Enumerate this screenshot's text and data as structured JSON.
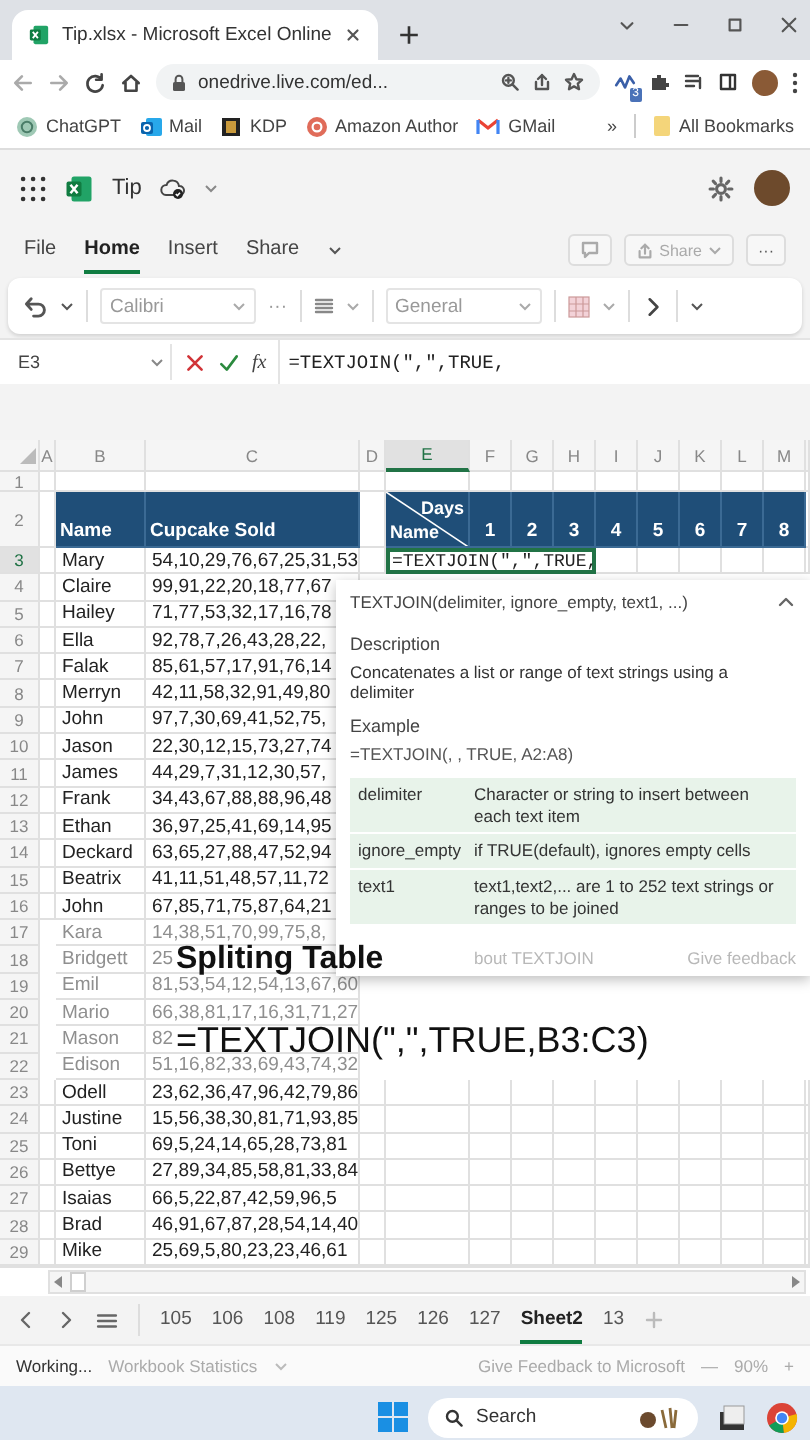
{
  "browser": {
    "tab_title": "Tip.xlsx - Microsoft Excel Online",
    "url": "onedrive.live.com/ed...",
    "extension_badge": "3",
    "bookmarks": [
      {
        "label": "ChatGPT",
        "kind": "ai"
      },
      {
        "label": "Mail",
        "kind": "mail"
      },
      {
        "label": "KDP",
        "kind": "book"
      },
      {
        "label": "Amazon Author",
        "kind": "author"
      },
      {
        "label": "GMail",
        "kind": "gmail"
      }
    ],
    "more": "»",
    "all_bookmarks": "All Bookmarks"
  },
  "app": {
    "file_name": "Tip"
  },
  "ribbon": {
    "tabs": [
      {
        "label": "File",
        "selected": false
      },
      {
        "label": "Home",
        "selected": true
      },
      {
        "label": "Insert",
        "selected": false
      },
      {
        "label": "Share",
        "selected": false
      }
    ],
    "share": "Share",
    "more": "···"
  },
  "toolbar": {
    "font": "Calibri",
    "more": "···",
    "number_format": "General"
  },
  "formula_bar": {
    "name_box": "E3",
    "fx": "fx",
    "formula": "=TEXTJOIN(\",\",TRUE,"
  },
  "sheet": {
    "columns": [
      {
        "label": "A",
        "selected": false
      },
      {
        "label": "B",
        "selected": false
      },
      {
        "label": "C",
        "selected": false
      },
      {
        "label": "D",
        "selected": false
      },
      {
        "label": "E",
        "selected": true
      },
      {
        "label": "F",
        "selected": false
      },
      {
        "label": "G",
        "selected": false
      },
      {
        "label": "H",
        "selected": false
      },
      {
        "label": "I",
        "selected": false
      },
      {
        "label": "J",
        "selected": false
      },
      {
        "label": "K",
        "selected": false
      },
      {
        "label": "L",
        "selected": false
      },
      {
        "label": "M",
        "selected": false
      }
    ],
    "empty_row": "1",
    "header": {
      "number": "2",
      "name": "Name",
      "sold": "Cupcake Sold",
      "corner_top": "Days",
      "corner_bottom": "Name",
      "days": [
        "1",
        "2",
        "3",
        "4",
        "5",
        "6",
        "7",
        "8"
      ]
    },
    "rows": [
      {
        "number": "3",
        "name": "Mary",
        "sold": "54,10,29,76,67,25,31,53",
        "selected": true,
        "faded": false,
        "editing": "=TEXTJOIN(\",\",TRUE,"
      },
      {
        "number": "4",
        "name": "Claire",
        "sold": "99,91,22,20,18,77,67",
        "selected": false,
        "faded": false
      },
      {
        "number": "5",
        "name": "Hailey",
        "sold": "71,77,53,32,17,16,78",
        "selected": false,
        "faded": false
      },
      {
        "number": "6",
        "name": "Ella",
        "sold": "92,78,7,26,43,28,22,",
        "selected": false,
        "faded": false
      },
      {
        "number": "7",
        "name": "Falak",
        "sold": "85,61,57,17,91,76,14",
        "selected": false,
        "faded": false
      },
      {
        "number": "8",
        "name": "Merryn",
        "sold": "42,11,58,32,91,49,80",
        "selected": false,
        "faded": false
      },
      {
        "number": "9",
        "name": "John",
        "sold": "97,7,30,69,41,52,75,",
        "selected": false,
        "faded": false
      },
      {
        "number": "10",
        "name": "Jason",
        "sold": "22,30,12,15,73,27,74",
        "selected": false,
        "faded": false
      },
      {
        "number": "11",
        "name": "James",
        "sold": "44,29,7,31,12,30,57,",
        "selected": false,
        "faded": false
      },
      {
        "number": "12",
        "name": "Frank",
        "sold": "34,43,67,88,88,96,48",
        "selected": false,
        "faded": false
      },
      {
        "number": "13",
        "name": "Ethan",
        "sold": "36,97,25,41,69,14,95",
        "selected": false,
        "faded": false
      },
      {
        "number": "14",
        "name": "Deckard",
        "sold": "63,65,27,88,47,52,94",
        "selected": false,
        "faded": false
      },
      {
        "number": "15",
        "name": "Beatrix",
        "sold": "41,11,51,48,57,11,72",
        "selected": false,
        "faded": false
      },
      {
        "number": "16",
        "name": "John",
        "sold": "67,85,71,75,87,64,21",
        "selected": false,
        "faded": false
      },
      {
        "number": "17",
        "name": "Kara",
        "sold": "14,38,51,70,99,75,8,",
        "selected": false,
        "faded": true
      },
      {
        "number": "18",
        "name": "Bridgett",
        "sold": "25",
        "selected": false,
        "faded": true
      },
      {
        "number": "19",
        "name": "Emil",
        "sold": "81,53,54,12,54,13,67,60",
        "selected": false,
        "faded": true
      },
      {
        "number": "20",
        "name": "Mario",
        "sold": "66,38,81,17,16,31,71,27",
        "selected": false,
        "faded": true
      },
      {
        "number": "21",
        "name": "Mason",
        "sold": "82",
        "selected": false,
        "faded": true
      },
      {
        "number": "22",
        "name": "Edison",
        "sold": "51,16,82,33,69,43,74,32",
        "selected": false,
        "faded": true
      },
      {
        "number": "23",
        "name": "Odell",
        "sold": "23,62,36,47,96,42,79,86",
        "selected": false,
        "faded": false
      },
      {
        "number": "24",
        "name": "Justine",
        "sold": "15,56,38,30,81,71,93,85",
        "selected": false,
        "faded": false
      },
      {
        "number": "25",
        "name": "Toni",
        "sold": "69,5,24,14,65,28,73,81",
        "selected": false,
        "faded": false
      },
      {
        "number": "26",
        "name": "Bettye",
        "sold": "27,89,34,85,58,81,33,84",
        "selected": false,
        "faded": false
      },
      {
        "number": "27",
        "name": "Isaias",
        "sold": "66,5,22,87,42,59,96,5",
        "selected": false,
        "faded": false
      },
      {
        "number": "28",
        "name": "Brad",
        "sold": "46,91,67,87,28,54,14,40",
        "selected": false,
        "faded": false
      },
      {
        "number": "29",
        "name": "Mike",
        "sold": "25,69,5,80,23,23,46,61",
        "selected": false,
        "faded": false
      }
    ]
  },
  "tooltip": {
    "signature": "TEXTJOIN(delimiter, ignore_empty, text1, ...)",
    "description_label": "Description",
    "description": "Concatenates a list or range of text strings using a delimiter",
    "example_label": "Example",
    "example": "=TEXTJOIN(, , TRUE, A2:A8)",
    "arguments": [
      {
        "name": "delimiter",
        "text": "Character or string to insert between each text item"
      },
      {
        "name": "ignore_empty",
        "text": "if TRUE(default), ignores empty cells"
      },
      {
        "name": "text1",
        "text": "text1,text2,... are 1 to 252 text strings or ranges to be joined"
      }
    ],
    "link": "bout TEXTJOIN",
    "feedback": "Give feedback"
  },
  "caption": {
    "title": "Spliting Table",
    "formula": "=TEXTJOIN(\",\",TRUE,B3:C3)"
  },
  "sheet_tabs": [
    {
      "label": "105",
      "selected": false
    },
    {
      "label": "106",
      "selected": false
    },
    {
      "label": "108",
      "selected": false
    },
    {
      "label": "119",
      "selected": false
    },
    {
      "label": "125",
      "selected": false
    },
    {
      "label": "126",
      "selected": false
    },
    {
      "label": "127",
      "selected": false
    },
    {
      "label": "Sheet2",
      "selected": true
    },
    {
      "label": "13",
      "selected": false
    }
  ],
  "status_bar": {
    "state": "Working...",
    "statistics": "Workbook Statistics",
    "feedback": "Give Feedback to Microsoft",
    "zoom_out": "—",
    "zoom": "90%",
    "zoom_in": "+"
  },
  "taskbar": {
    "search": "Search"
  }
}
